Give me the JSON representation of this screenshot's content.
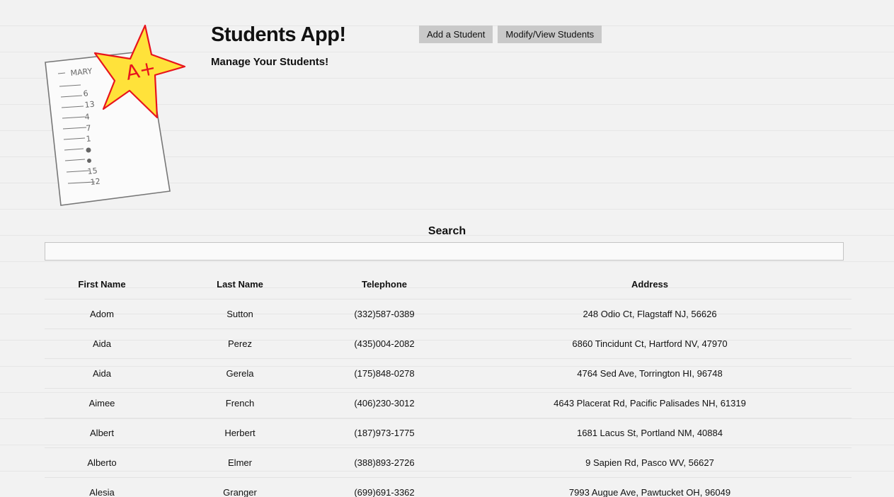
{
  "header": {
    "title": "Students App!",
    "subtitle": "Manage Your Students!"
  },
  "nav": {
    "add_label": "Add a Student",
    "modify_label": "Modify/View Students"
  },
  "search": {
    "label": "Search",
    "value": ""
  },
  "table": {
    "columns": [
      "First Name",
      "Last Name",
      "Telephone",
      "Address"
    ],
    "rows": [
      [
        "Adom",
        "Sutton",
        "(332)587-0389",
        "248 Odio Ct, Flagstaff NJ, 56626"
      ],
      [
        "Aida",
        "Perez",
        "(435)004-2082",
        "6860 Tincidunt Ct, Hartford NV, 47970"
      ],
      [
        "Aida",
        "Gerela",
        "(175)848-0278",
        "4764 Sed Ave, Torrington HI, 96748"
      ],
      [
        "Aimee",
        "French",
        "(406)230-3012",
        "4643 Placerat Rd, Pacific Palisades NH, 61319"
      ],
      [
        "Albert",
        "Herbert",
        "(187)973-1775",
        "1681 Lacus St, Portland NM, 40884"
      ],
      [
        "Alberto",
        "Elmer",
        "(388)893-2726",
        "9 Sapien Rd, Pasco WV, 56627"
      ],
      [
        "Alesia",
        "Granger",
        "(699)691-3362",
        "7993 Augue Ave, Pawtucket OH, 96049"
      ]
    ]
  },
  "logo": {
    "grade": "A+",
    "paper_name": "MARY",
    "star_color": "#ffe23a",
    "ink_color": "#e8141d"
  }
}
